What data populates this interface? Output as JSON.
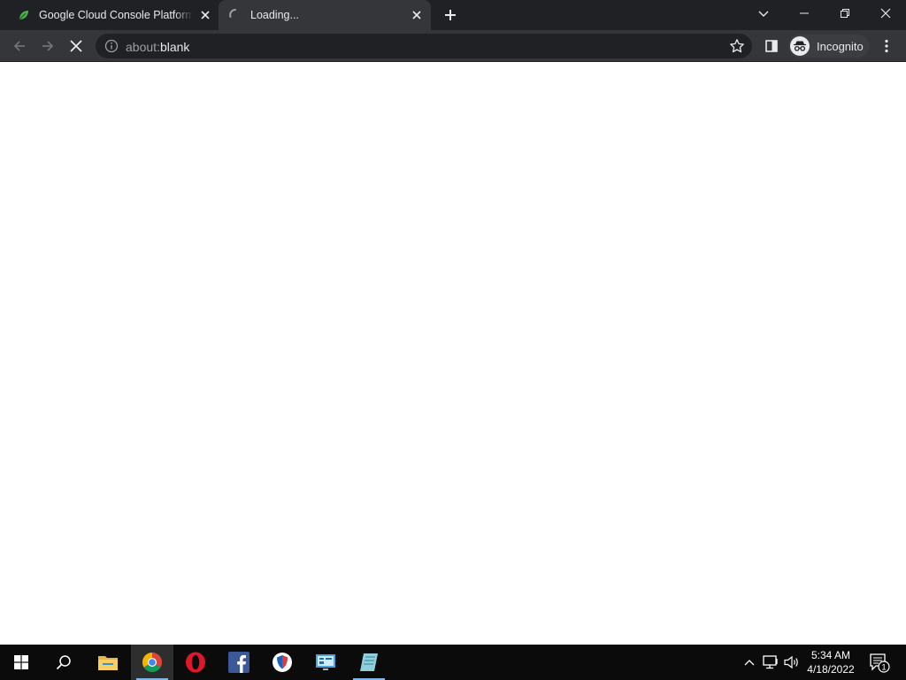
{
  "browser": {
    "tabs": [
      {
        "title": "Google Cloud Console Platform",
        "favicon": "leaf-favicon-icon"
      },
      {
        "title": "Loading...",
        "favicon": "loading-spinner-icon"
      }
    ],
    "address": {
      "scheme": "about:",
      "path": "blank"
    },
    "profile_label": "Incognito"
  },
  "taskbar": {
    "apps": [
      "file-explorer-icon",
      "chrome-icon",
      "opera-icon",
      "facebook-icon",
      "brave-icon",
      "control-panel-icon",
      "notes-icon"
    ],
    "time": "5:34 AM",
    "date": "4/18/2022",
    "notification_count": "1"
  },
  "colors": {
    "tab_strip": "#202124",
    "toolbar": "#35363a",
    "taskbar": "#0b0b0b",
    "accent": "#7fb8e6"
  }
}
